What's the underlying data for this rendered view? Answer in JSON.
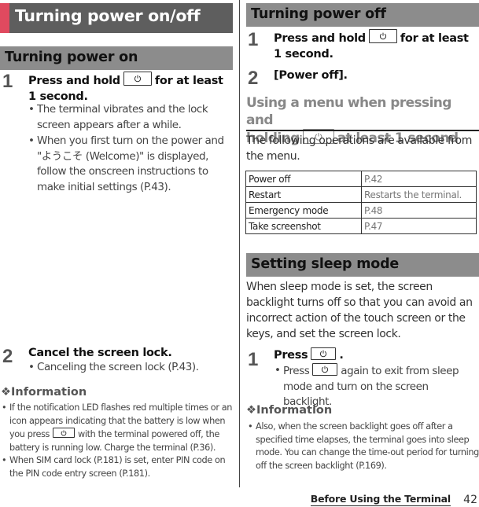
{
  "chapter": {
    "title": "Turning power on/off",
    "accent_color": "#e04a5f",
    "bar_color": "#5e5e5e"
  },
  "left": {
    "section_title": "Turning power on",
    "steps": [
      {
        "num": "1",
        "text_before": "Press and hold",
        "key": "power-key",
        "text_after": "for at least 1 second.",
        "bullets": [
          "The terminal vibrates and the lock screen appears after a while.",
          "When you first turn on the power and \"ようこそ (Welcome)\" is displayed, follow the onscreen instructions to make initial settings (P.43)."
        ]
      },
      {
        "num": "2",
        "text": "Cancel the screen lock.",
        "bullets": [
          "Canceling the screen lock (P.43)."
        ]
      }
    ],
    "info": {
      "heading": "❖Information",
      "items": [
        {
          "before": "If the notification LED flashes red multiple times or an icon appears indicating that the battery is low when you press",
          "key": "power-key",
          "after": "with the terminal powered off, the battery is running low. Charge the terminal (P.36)."
        },
        {
          "text": "When SIM card lock (P.181) is set, enter PIN code on the PIN code entry screen (P.181)."
        }
      ]
    }
  },
  "right": {
    "section_off": {
      "title": "Turning power off",
      "steps": [
        {
          "num": "1",
          "text_before": "Press and hold",
          "key": "power-key",
          "text_after": "for at least 1 second."
        },
        {
          "num": "2",
          "text": "[Power off]."
        }
      ]
    },
    "menu_section": {
      "title_line1": "Using a menu when pressing and",
      "title_line2_before": "holding",
      "title_line2_after": "at least 1 second",
      "intro": "The following operations are available from the menu.",
      "table": [
        {
          "item": "Power off",
          "ref": "P.42"
        },
        {
          "item": "Restart",
          "ref": "Restarts the terminal."
        },
        {
          "item": "Emergency mode",
          "ref": "P.48"
        },
        {
          "item": "Take screenshot",
          "ref": "P.47"
        }
      ]
    },
    "sleep_section": {
      "title": "Setting sleep mode",
      "intro": "When sleep mode is set, the screen backlight turns off so that you can avoid an incorrect action of the touch screen or the keys, and set the screen lock.",
      "step": {
        "num": "1",
        "text_before": "Press",
        "text_after": ".",
        "bullet_before": "Press",
        "bullet_after": "again to exit from sleep mode and turn on the screen backlight."
      },
      "info": {
        "heading": "❖Information",
        "items": [
          "Also, when the screen backlight goes off after a specified time elapses, the terminal goes into sleep mode. You can change the time-out period for turning off the screen backlight (P.169)."
        ]
      }
    }
  },
  "footer": {
    "section": "Before Using the Terminal",
    "page": "42"
  }
}
